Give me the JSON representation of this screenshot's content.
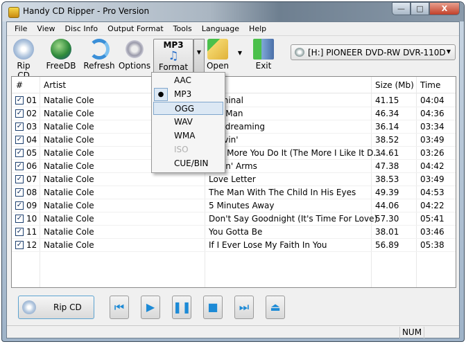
{
  "window": {
    "title": "Handy CD Ripper - Pro Version",
    "minimize": "—",
    "maximize": "□",
    "close": "X"
  },
  "menubar": [
    "File",
    "View",
    "Disc Info",
    "Output Format",
    "Tools",
    "Language",
    "Help"
  ],
  "toolbar": {
    "rip_cd": "Rip CD",
    "freedb": "FreeDB",
    "refresh": "Refresh",
    "options": "Options",
    "format_current": "MP3",
    "format": "Format",
    "open": "Open",
    "exit": "Exit"
  },
  "drive": {
    "selected": "[H:] PIONEER DVD-RW  DVR-110D"
  },
  "format_menu": {
    "items": [
      {
        "label": "AAC"
      },
      {
        "label": "MP3",
        "checked": true
      },
      {
        "label": "OGG",
        "highlighted": true
      },
      {
        "label": "WAV"
      },
      {
        "label": "WMA"
      },
      {
        "label": "ISO",
        "disabled": true
      },
      {
        "label": "CUE/BIN"
      }
    ]
  },
  "table": {
    "headers": {
      "num": "#",
      "artist": "Artist",
      "size": "Size (Mb)",
      "time": "Time"
    },
    "rows": [
      {
        "num": "01",
        "artist": "Natalie Cole",
        "title": "Criminal",
        "size": "41.15",
        "time": "04:04",
        "checked": true
      },
      {
        "num": "02",
        "artist": "Natalie Cole",
        "title": "Old Man",
        "size": "46.34",
        "time": "04:36",
        "checked": true
      },
      {
        "num": "03",
        "artist": "Natalie Cole",
        "title": "Daydreaming",
        "size": "36.14",
        "time": "03:34",
        "checked": true
      },
      {
        "num": "04",
        "artist": "Natalie Cole",
        "title": "Leavin'",
        "size": "38.52",
        "time": "03:49",
        "checked": true
      },
      {
        "num": "05",
        "artist": "Natalie Cole",
        "title": "The More You Do It (The More I Like It D...",
        "size": "34.61",
        "time": "03:26",
        "checked": true
      },
      {
        "num": "06",
        "artist": "Natalie Cole",
        "title": "Lovin' Arms",
        "size": "47.38",
        "time": "04:42",
        "checked": true
      },
      {
        "num": "07",
        "artist": "Natalie Cole",
        "title": "Love Letter",
        "size": "38.53",
        "time": "03:49",
        "checked": true
      },
      {
        "num": "08",
        "artist": "Natalie Cole",
        "title": "The Man With The Child In His Eyes",
        "size": "49.39",
        "time": "04:53",
        "checked": true
      },
      {
        "num": "09",
        "artist": "Natalie Cole",
        "title": "5 Minutes Away",
        "size": "44.06",
        "time": "04:22",
        "checked": true
      },
      {
        "num": "10",
        "artist": "Natalie Cole",
        "title": "Don't Say Goodnight (It's Time For Love)",
        "size": "57.30",
        "time": "05:41",
        "checked": true
      },
      {
        "num": "11",
        "artist": "Natalie Cole",
        "title": "You Gotta Be",
        "size": "38.01",
        "time": "03:46",
        "checked": true
      },
      {
        "num": "12",
        "artist": "Natalie Cole",
        "title": "If I Ever Lose My Faith In You",
        "size": "56.89",
        "time": "05:38",
        "checked": true
      }
    ]
  },
  "bottom": {
    "rip_cd": "Rip CD",
    "player": [
      "previous-icon",
      "play-icon",
      "pause-icon",
      "stop-icon",
      "next-icon",
      "eject-icon"
    ]
  },
  "status": {
    "num": "NUM"
  },
  "colors": {
    "accent": "#1c8ad6",
    "highlight": "#dce8f4"
  }
}
